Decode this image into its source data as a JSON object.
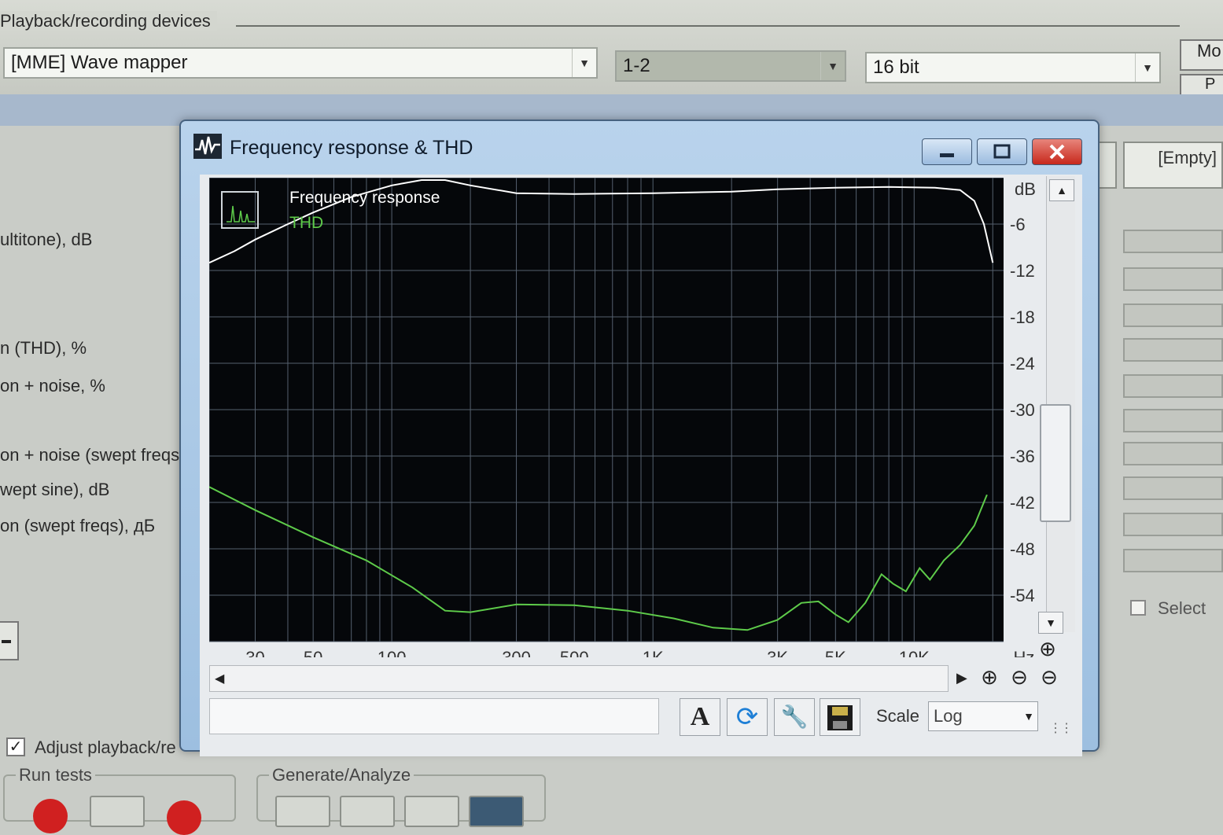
{
  "app": {
    "group_title": "Playback/recording devices",
    "device_combo": "[MME] Wave mapper",
    "channels_combo": "1-2",
    "bits_combo": "16 bit",
    "side_btn_1": "Mo",
    "side_btn_2": "P",
    "left_labels": [
      "ultitone), dB",
      "n (THD), %",
      "on + noise, %",
      "on + noise (swept freqs",
      "wept sine), dB",
      "on (swept freqs), дБ"
    ],
    "right_cell_label": "[Empty]",
    "select_label": "Select",
    "adjust_label": "Adjust playback/re",
    "run_tests_label": "Run tests",
    "generate_label": "Generate/Analyze"
  },
  "window": {
    "title": "Frequency response & THD",
    "scale_label": "Scale",
    "scale_value": "Log",
    "status_text": ""
  },
  "chart_data": {
    "type": "line",
    "title": "",
    "xlabel": "",
    "ylabel": "",
    "x_unit": "Hz",
    "y_unit": "dB",
    "x_scale": "log",
    "xlim": [
      20,
      22000
    ],
    "ylim": [
      -60,
      0
    ],
    "x_ticks": [
      {
        "v": 30,
        "label": "30"
      },
      {
        "v": 50,
        "label": "50"
      },
      {
        "v": 100,
        "label": "100"
      },
      {
        "v": 300,
        "label": "300"
      },
      {
        "v": 500,
        "label": "500"
      },
      {
        "v": 1000,
        "label": "1K"
      },
      {
        "v": 3000,
        "label": "3K"
      },
      {
        "v": 5000,
        "label": "5K"
      },
      {
        "v": 10000,
        "label": "10K"
      }
    ],
    "y_ticks": [
      {
        "v": -6,
        "label": "-6"
      },
      {
        "v": -12,
        "label": "-12"
      },
      {
        "v": -18,
        "label": "-18"
      },
      {
        "v": -24,
        "label": "-24"
      },
      {
        "v": -30,
        "label": "-30"
      },
      {
        "v": -36,
        "label": "-36"
      },
      {
        "v": -42,
        "label": "-42"
      },
      {
        "v": -48,
        "label": "-48"
      },
      {
        "v": -54,
        "label": "-54"
      }
    ],
    "grid": true,
    "legend_position": "top-left",
    "series": [
      {
        "name": "Frequency response",
        "color": "#ffffff",
        "points": [
          [
            20,
            -11
          ],
          [
            25,
            -9.5
          ],
          [
            30,
            -8
          ],
          [
            40,
            -6
          ],
          [
            50,
            -4.5
          ],
          [
            70,
            -2.5
          ],
          [
            100,
            -1
          ],
          [
            130,
            -0.3
          ],
          [
            160,
            -0.3
          ],
          [
            200,
            -1
          ],
          [
            300,
            -2
          ],
          [
            500,
            -2.1
          ],
          [
            1000,
            -2
          ],
          [
            2000,
            -1.8
          ],
          [
            3000,
            -1.5
          ],
          [
            5000,
            -1.3
          ],
          [
            8000,
            -1.2
          ],
          [
            12000,
            -1.3
          ],
          [
            15000,
            -1.6
          ],
          [
            17000,
            -3
          ],
          [
            18500,
            -6
          ],
          [
            20000,
            -11
          ]
        ]
      },
      {
        "name": "THD",
        "color": "#5ecb4a",
        "points": [
          [
            20,
            -40
          ],
          [
            30,
            -43
          ],
          [
            50,
            -46.5
          ],
          [
            80,
            -49.5
          ],
          [
            120,
            -53
          ],
          [
            160,
            -56
          ],
          [
            200,
            -56.2
          ],
          [
            300,
            -55.2
          ],
          [
            500,
            -55.3
          ],
          [
            800,
            -56
          ],
          [
            1200,
            -57
          ],
          [
            1700,
            -58.2
          ],
          [
            2300,
            -58.5
          ],
          [
            3000,
            -57.2
          ],
          [
            3700,
            -55
          ],
          [
            4300,
            -54.8
          ],
          [
            5000,
            -56.5
          ],
          [
            5600,
            -57.5
          ],
          [
            6500,
            -55
          ],
          [
            7500,
            -51.3
          ],
          [
            8300,
            -52.5
          ],
          [
            9300,
            -53.5
          ],
          [
            10500,
            -50.5
          ],
          [
            11500,
            -52
          ],
          [
            13000,
            -49.5
          ],
          [
            15000,
            -47.5
          ],
          [
            17000,
            -45
          ],
          [
            19000,
            -41
          ]
        ]
      }
    ]
  }
}
